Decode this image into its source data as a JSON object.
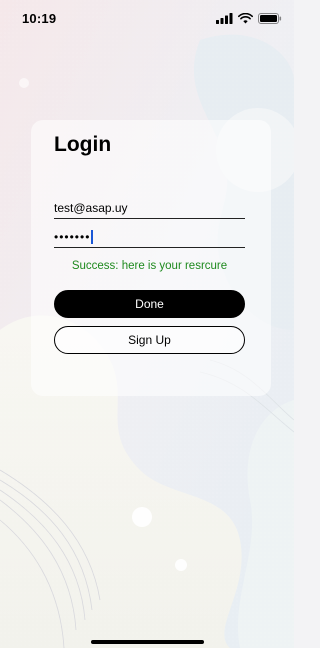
{
  "status_bar": {
    "time": "10:19",
    "icons": [
      "signal-icon",
      "wifi-icon",
      "battery-icon"
    ]
  },
  "login": {
    "title": "Login",
    "email_value": "test@asap.uy",
    "password_masked": "•••••••",
    "success_message": "Success: here is your resrcure",
    "done_label": "Done",
    "signup_label": "Sign Up"
  },
  "colors": {
    "success": "#1e8a1e",
    "primary_button": "#000000",
    "caret": "#1a57d6"
  }
}
